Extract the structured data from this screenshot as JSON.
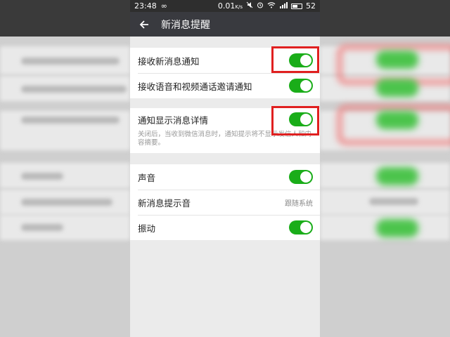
{
  "status_bar": {
    "time": "23:48",
    "loop_symbol": "∞",
    "net_speed": "0.01",
    "net_unit": "K/s",
    "battery_level": "52"
  },
  "title_bar": {
    "back_icon": "arrow-left-icon",
    "title": "新消息提醒"
  },
  "groups": [
    {
      "items": [
        {
          "label": "接收新消息通知",
          "toggle_on": true
        },
        {
          "label": "接收语音和视频通话邀请通知",
          "toggle_on": true
        }
      ]
    },
    {
      "items": [
        {
          "label": "通知显示消息详情",
          "toggle_on": true,
          "description": "关闭后，当收到微信消息时，通知提示将不显示发信人和内容摘要。"
        }
      ]
    },
    {
      "items": [
        {
          "label": "声音",
          "toggle_on": true
        },
        {
          "label": "新消息提示音",
          "value": "跟随系统"
        },
        {
          "label": "振动",
          "toggle_on": true
        }
      ]
    }
  ],
  "colors": {
    "toggle_on": "#1aad19",
    "titlebar_bg": "#393a3f",
    "highlight_box": "#e02020"
  }
}
